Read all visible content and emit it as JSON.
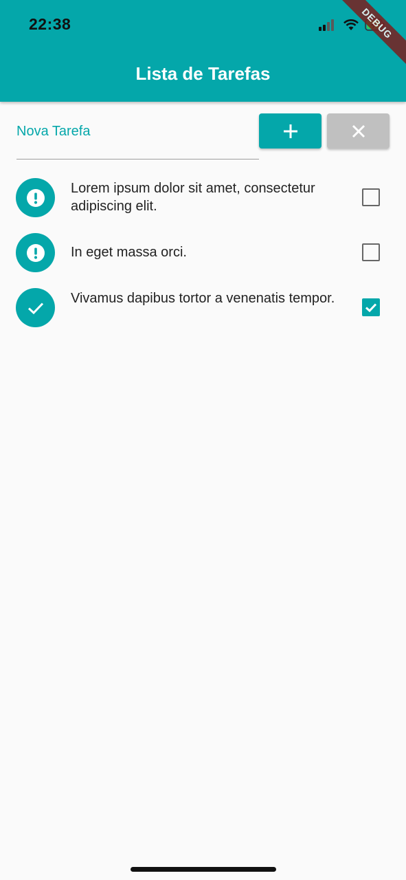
{
  "status_bar": {
    "time": "22:38"
  },
  "debug_banner": "DEBUG",
  "app": {
    "title": "Lista de Tarefas"
  },
  "input": {
    "placeholder": "Nova Tarefa",
    "value": ""
  },
  "buttons": {
    "add_icon": "plus-icon",
    "clear_icon": "close-icon"
  },
  "tasks": [
    {
      "text": "Lorem ipsum dolor sit amet, consectetur adipiscing elit.",
      "icon": "exclamation-icon",
      "done": false
    },
    {
      "text": "In eget massa orci.",
      "icon": "exclamation-icon",
      "done": false
    },
    {
      "text": "Vivamus dapibus tortor a venenatis tempor.",
      "icon": "check-icon",
      "done": true
    }
  ],
  "colors": {
    "accent": "#04a7aa",
    "clear_button": "#c0c0c0",
    "background": "#fafafa"
  }
}
